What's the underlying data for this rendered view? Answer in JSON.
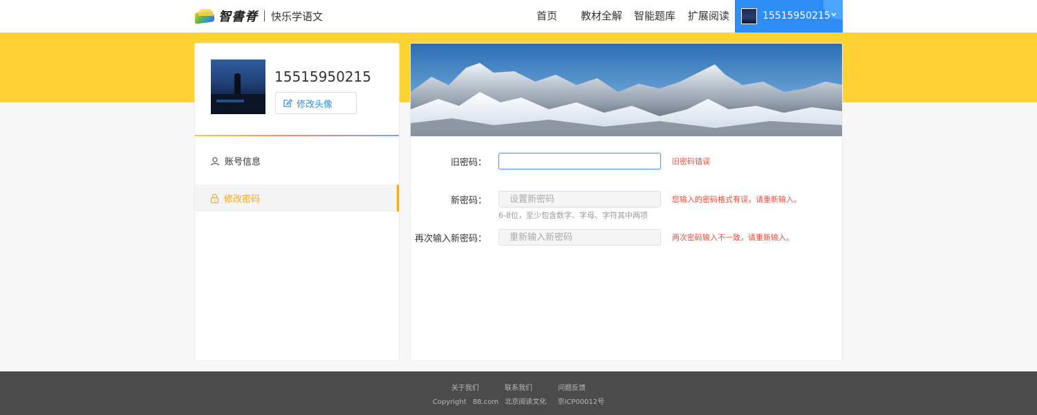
{
  "header": {
    "brand": "智書脊",
    "slogan": "快乐学语文",
    "nav": [
      "首页",
      "教材全解",
      "智能题库",
      "扩展阅读"
    ],
    "user": "15515950215"
  },
  "profile": {
    "name": "15515950215",
    "edit_avatar": "修改头像"
  },
  "sidebar": {
    "items": [
      {
        "label": "账号信息",
        "icon": "user-icon",
        "active": false
      },
      {
        "label": "修改密码",
        "icon": "lock-icon",
        "active": true
      }
    ]
  },
  "form": {
    "old_password": {
      "label": "旧密码：",
      "value": "",
      "placeholder": "",
      "error": "旧密码错误"
    },
    "new_password": {
      "label": "新密码：",
      "value": "",
      "placeholder": "设置新密码",
      "hint": "6-8位，至少包含数字、字母、字符其中两项",
      "error": "您输入的密码格式有误，请重新输入。"
    },
    "confirm_password": {
      "label": "再次输入新密码：",
      "value": "",
      "placeholder": "重新输入新密码",
      "error": "两次密码输入不一致，请重新输入。"
    }
  },
  "footer": {
    "links": [
      "关于我们",
      "联系我们",
      "问题反馈"
    ],
    "copyright": [
      "Copyright",
      "88.com",
      "北京阅读文化",
      "京ICP00012号"
    ]
  },
  "colors": {
    "accent_blue": "#2e8df5",
    "band_yellow": "#ffd234",
    "active_orange": "#f5a623",
    "error_red": "#f04a3a",
    "footer_bg": "#4b4b4b"
  }
}
